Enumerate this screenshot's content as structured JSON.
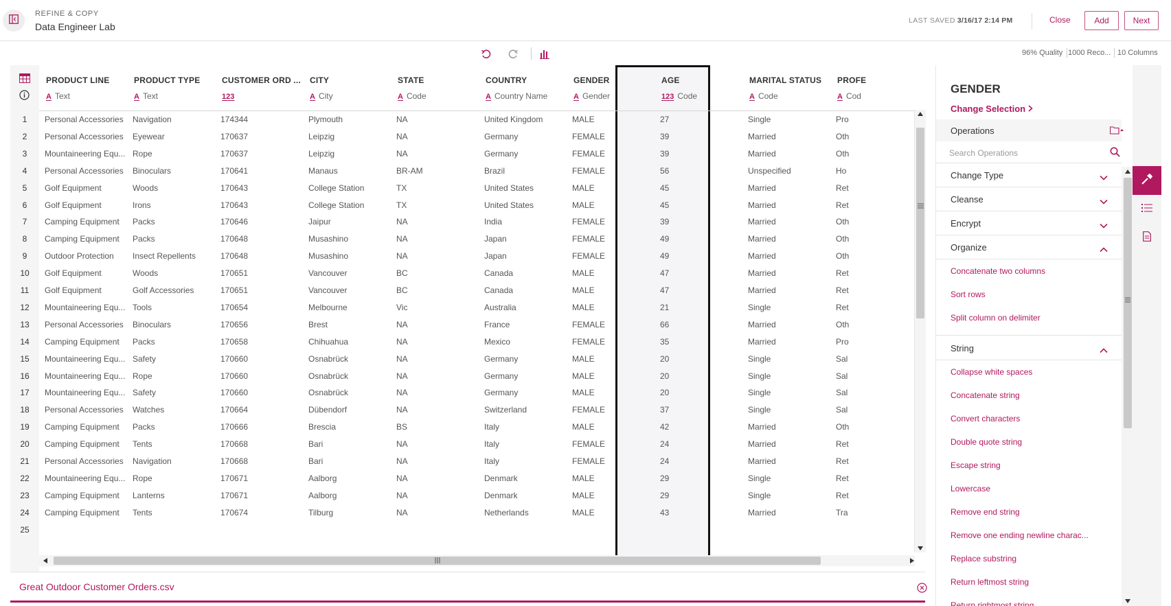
{
  "header": {
    "subtitle": "REFINE & COPY",
    "title": "Data Engineer Lab",
    "saved_label": "LAST SAVED",
    "saved_value": "3/16/17 2:14 PM",
    "close_label": "Close",
    "add_label": "Add",
    "next_label": "Next"
  },
  "toolbar": {
    "undo_icon": "undo-icon",
    "redo_icon": "redo-icon",
    "chart_icon": "bar-chart-icon"
  },
  "stats": {
    "quality": "96% Quality",
    "records": "1000 Reco...",
    "columns": "10 Columns"
  },
  "grid": {
    "columns": [
      {
        "name": "PRODUCT LINE",
        "type_icon": "A",
        "type": "Text"
      },
      {
        "name": "PRODUCT TYPE",
        "type_icon": "A",
        "type": "Text"
      },
      {
        "name": "CUSTOMER ORD ...",
        "type_icon": "123",
        "type": ""
      },
      {
        "name": "CITY",
        "type_icon": "A",
        "type": "City"
      },
      {
        "name": "STATE",
        "type_icon": "A",
        "type": "Code"
      },
      {
        "name": "COUNTRY",
        "type_icon": "A",
        "type": "Country Name"
      },
      {
        "name": "GENDER",
        "type_icon": "A",
        "type": "Gender"
      },
      {
        "name": "AGE",
        "type_icon": "123",
        "type": "Code"
      },
      {
        "name": "MARITAL STATUS",
        "type_icon": "A",
        "type": "Code"
      },
      {
        "name": "PROFE",
        "type_icon": "A",
        "type": "Cod"
      }
    ],
    "rows": [
      [
        "1",
        "Personal Accessories",
        "Navigation",
        "174344",
        "Plymouth",
        "NA",
        "United Kingdom",
        "MALE",
        "27",
        "Single",
        "Pro"
      ],
      [
        "2",
        "Personal Accessories",
        "Eyewear",
        "170637",
        "Leipzig",
        "NA",
        "Germany",
        "FEMALE",
        "39",
        "Married",
        "Oth"
      ],
      [
        "3",
        "Mountaineering Equ...",
        "Rope",
        "170637",
        "Leipzig",
        "NA",
        "Germany",
        "FEMALE",
        "39",
        "Married",
        "Oth"
      ],
      [
        "4",
        "Personal Accessories",
        "Binoculars",
        "170641",
        "Manaus",
        "BR-AM",
        "Brazil",
        "FEMALE",
        "56",
        "Unspecified",
        "Ho"
      ],
      [
        "5",
        "Golf Equipment",
        "Woods",
        "170643",
        "College Station",
        "TX",
        "United States",
        "MALE",
        "45",
        "Married",
        "Ret"
      ],
      [
        "6",
        "Golf Equipment",
        "Irons",
        "170643",
        "College Station",
        "TX",
        "United States",
        "MALE",
        "45",
        "Married",
        "Ret"
      ],
      [
        "7",
        "Camping Equipment",
        "Packs",
        "170646",
        "Jaipur",
        "NA",
        "India",
        "FEMALE",
        "39",
        "Married",
        "Oth"
      ],
      [
        "8",
        "Camping Equipment",
        "Packs",
        "170648",
        "Musashino",
        "NA",
        "Japan",
        "FEMALE",
        "49",
        "Married",
        "Oth"
      ],
      [
        "9",
        "Outdoor Protection",
        "Insect Repellents",
        "170648",
        "Musashino",
        "NA",
        "Japan",
        "FEMALE",
        "49",
        "Married",
        "Oth"
      ],
      [
        "10",
        "Golf Equipment",
        "Woods",
        "170651",
        "Vancouver",
        "BC",
        "Canada",
        "MALE",
        "47",
        "Married",
        "Ret"
      ],
      [
        "11",
        "Golf Equipment",
        "Golf Accessories",
        "170651",
        "Vancouver",
        "BC",
        "Canada",
        "MALE",
        "47",
        "Married",
        "Ret"
      ],
      [
        "12",
        "Mountaineering Equ...",
        "Tools",
        "170654",
        "Melbourne",
        "Vic",
        "Australia",
        "MALE",
        "21",
        "Single",
        "Ret"
      ],
      [
        "13",
        "Personal Accessories",
        "Binoculars",
        "170656",
        "Brest",
        "NA",
        "France",
        "FEMALE",
        "66",
        "Married",
        "Oth"
      ],
      [
        "14",
        "Camping Equipment",
        "Packs",
        "170658",
        "Chihuahua",
        "NA",
        "Mexico",
        "FEMALE",
        "35",
        "Married",
        "Pro"
      ],
      [
        "15",
        "Mountaineering Equ...",
        "Safety",
        "170660",
        "Osnabrück",
        "NA",
        "Germany",
        "MALE",
        "20",
        "Single",
        "Sal"
      ],
      [
        "16",
        "Mountaineering Equ...",
        "Rope",
        "170660",
        "Osnabrück",
        "NA",
        "Germany",
        "MALE",
        "20",
        "Single",
        "Sal"
      ],
      [
        "17",
        "Mountaineering Equ...",
        "Safety",
        "170660",
        "Osnabrück",
        "NA",
        "Germany",
        "MALE",
        "20",
        "Single",
        "Sal"
      ],
      [
        "18",
        "Personal Accessories",
        "Watches",
        "170664",
        "Dübendorf",
        "NA",
        "Switzerland",
        "FEMALE",
        "37",
        "Single",
        "Sal"
      ],
      [
        "19",
        "Camping Equipment",
        "Packs",
        "170666",
        "Brescia",
        "BS",
        "Italy",
        "MALE",
        "42",
        "Married",
        "Oth"
      ],
      [
        "20",
        "Camping Equipment",
        "Tents",
        "170668",
        "Bari",
        "NA",
        "Italy",
        "FEMALE",
        "24",
        "Married",
        "Ret"
      ],
      [
        "21",
        "Personal Accessories",
        "Navigation",
        "170668",
        "Bari",
        "NA",
        "Italy",
        "FEMALE",
        "24",
        "Married",
        "Ret"
      ],
      [
        "22",
        "Mountaineering Equ...",
        "Rope",
        "170671",
        "Aalborg",
        "NA",
        "Denmark",
        "MALE",
        "29",
        "Single",
        "Ret"
      ],
      [
        "23",
        "Camping Equipment",
        "Lanterns",
        "170671",
        "Aalborg",
        "NA",
        "Denmark",
        "MALE",
        "29",
        "Single",
        "Ret"
      ],
      [
        "24",
        "Camping Equipment",
        "Tents",
        "170674",
        "Tilburg",
        "NA",
        "Netherlands",
        "MALE",
        "43",
        "Married",
        "Tra"
      ],
      [
        "25",
        "",
        "",
        "",
        "",
        "",
        "",
        "",
        "",
        "",
        ""
      ]
    ]
  },
  "footer": {
    "filename": "Great Outdoor Customer Orders.csv"
  },
  "panel": {
    "title": "GENDER",
    "change_selection": "Change Selection",
    "operations_label": "Operations",
    "search_placeholder": "Search Operations",
    "sections": [
      {
        "label": "Change Type",
        "expanded": false,
        "items": []
      },
      {
        "label": "Cleanse",
        "expanded": false,
        "items": []
      },
      {
        "label": "Encrypt",
        "expanded": false,
        "items": []
      },
      {
        "label": "Organize",
        "expanded": true,
        "items": [
          "Concatenate two columns",
          "Sort rows",
          "Split column on delimiter"
        ]
      },
      {
        "label": "String",
        "expanded": true,
        "items": [
          "Collapse white spaces",
          "Concatenate string",
          "Convert characters",
          "Double quote string",
          "Escape string",
          "Lowercase",
          "Remove end string",
          "Remove one ending newline charac...",
          "Replace substring",
          "Return leftmost string",
          "Return rightmost string"
        ]
      }
    ]
  },
  "rail": {
    "items": [
      "wrench-icon",
      "list-icon",
      "document-icon"
    ]
  },
  "colors": {
    "accent": "#b0185f",
    "selection_border": "#111111"
  }
}
